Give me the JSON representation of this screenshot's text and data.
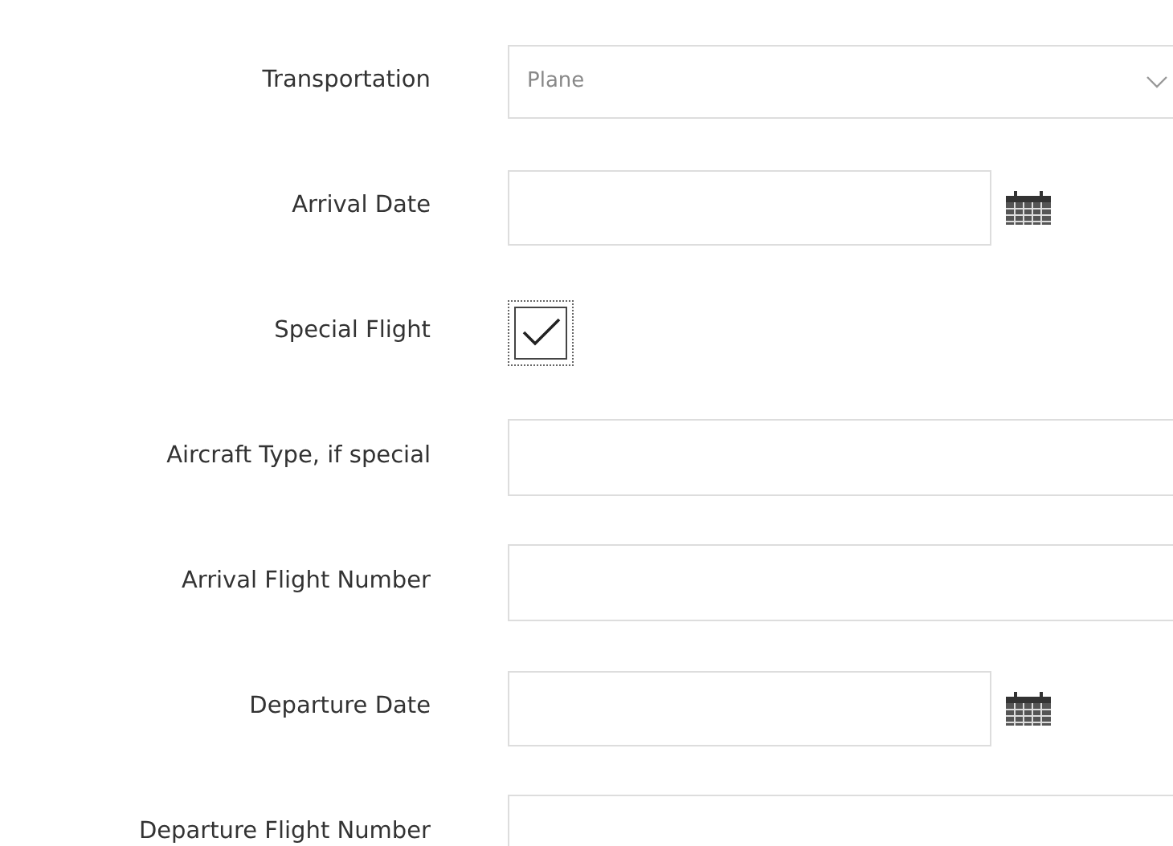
{
  "fields": [
    {
      "kind": "select",
      "label": "Transportation",
      "value": "Plane"
    },
    {
      "kind": "date",
      "label": "Arrival Date"
    },
    {
      "kind": "checkbox",
      "label": "Special Flight",
      "checked": true
    },
    {
      "kind": "text",
      "label": "Aircraft Type, if special"
    },
    {
      "kind": "text",
      "label": "Arrival Flight Number"
    },
    {
      "kind": "date",
      "label": "Departure Date"
    },
    {
      "kind": "text",
      "label": "Departure Flight Number"
    }
  ]
}
